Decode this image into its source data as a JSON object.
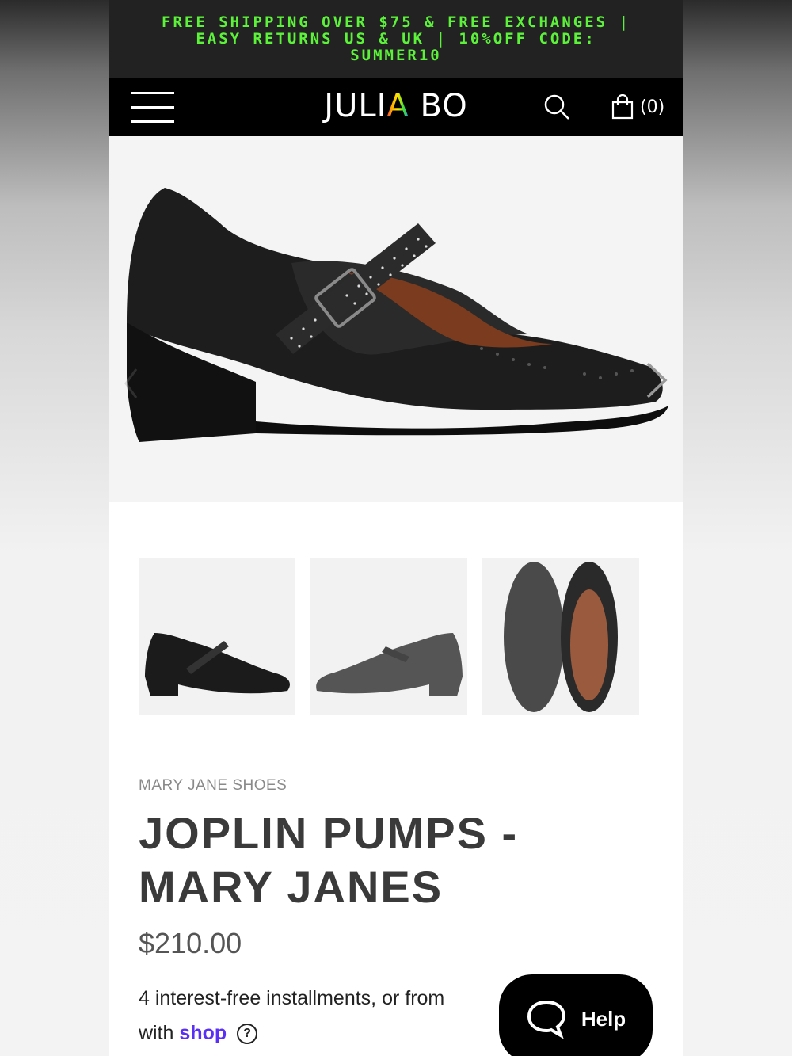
{
  "promo": {
    "text": "FREE SHIPPING OVER $75 & FREE EXCHANGES | EASY RETURNS US & UK | 10%OFF CODE: SUMMER10",
    "color": "#5df23a"
  },
  "header": {
    "logo_left": "JULI",
    "logo_accent": "A",
    "logo_right": " BO",
    "cart_count": "(0)",
    "icons": [
      "menu-icon",
      "search-icon",
      "shopping-bag-icon"
    ]
  },
  "gallery": {
    "thumbnails": [
      "side view",
      "side view grey",
      "top and sole view"
    ]
  },
  "product": {
    "category": "MARY JANE SHOES",
    "title_line1": "JOPLIN PUMPS -",
    "title_line2": "MARY JANES",
    "price": "$210.00",
    "installments_text": "4 interest-free installments, or from",
    "with_text": "with",
    "shop_brand": "shop",
    "shop_color": "#5a31f4"
  },
  "help": {
    "label": "Help"
  }
}
